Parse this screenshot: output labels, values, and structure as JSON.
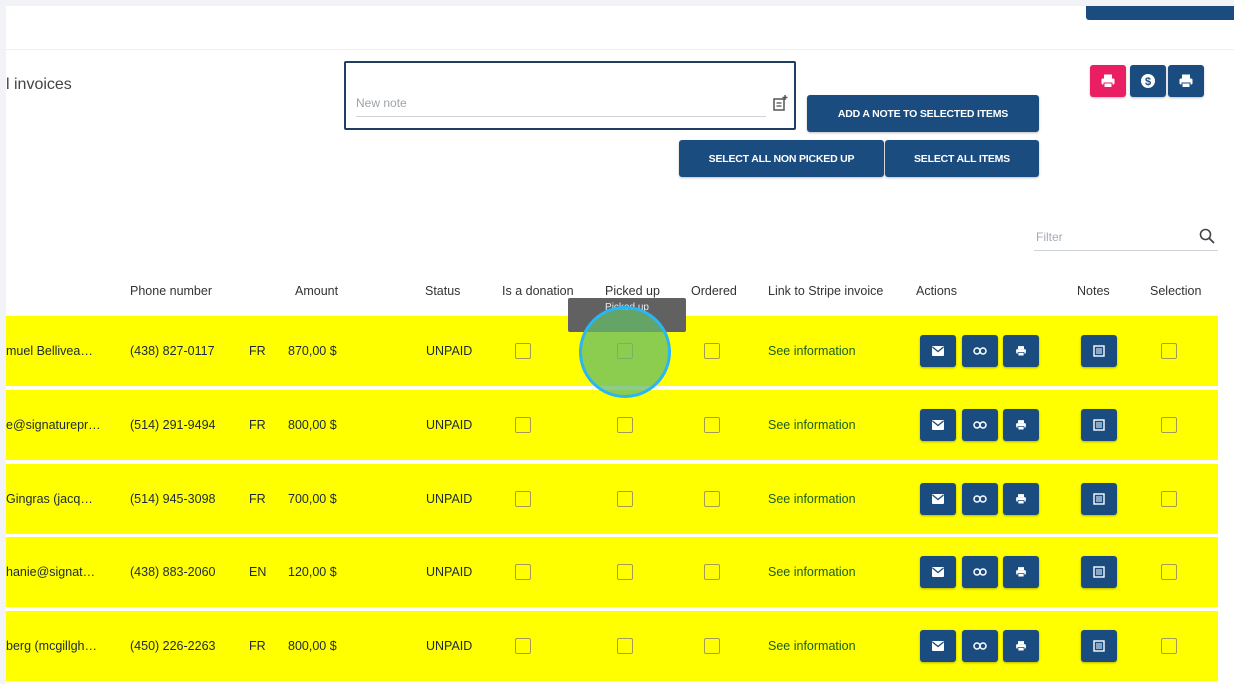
{
  "header": {
    "section_title": "l invoices"
  },
  "note": {
    "placeholder": "New note",
    "add_note_label": "ADD A NOTE TO SELECTED ITEMS",
    "select_non_picked_label": "SELECT ALL NON PICKED UP",
    "select_all_label": "SELECT ALL ITEMS"
  },
  "toolbar_icons": [
    "print-icon",
    "dollar-icon",
    "print-icon"
  ],
  "filter": {
    "placeholder": "Filter"
  },
  "table": {
    "headers": {
      "phone": "Phone number",
      "amount": "Amount",
      "status": "Status",
      "donation": "Is a donation",
      "picked": "Picked up",
      "ordered": "Ordered",
      "link": "Link to Stripe invoice",
      "actions": "Actions",
      "notes": "Notes",
      "selection": "Selection"
    },
    "rows": [
      {
        "name": "muel Bellivea…",
        "phone": "(438) 827-0117",
        "lang": "FR",
        "amount": "870,00 $",
        "status": "UNPAID",
        "link": "See information"
      },
      {
        "name": "e@signaturepr…",
        "phone": "(514) 291-9494",
        "lang": "FR",
        "amount": "800,00 $",
        "status": "UNPAID",
        "link": "See information"
      },
      {
        "name": "Gingras (jacq…",
        "phone": "(514) 945-3098",
        "lang": "FR",
        "amount": "700,00 $",
        "status": "UNPAID",
        "link": "See information"
      },
      {
        "name": "hanie@signat…",
        "phone": "(438) 883-2060",
        "lang": "EN",
        "amount": "120,00 $",
        "status": "UNPAID",
        "link": "See information"
      },
      {
        "name": "berg (mcgillgh…",
        "phone": "(450) 226-2263",
        "lang": "FR",
        "amount": "800,00 $",
        "status": "UNPAID",
        "link": "See information"
      }
    ]
  },
  "tooltip": {
    "text": "Picked up"
  },
  "colors": {
    "primary": "#1a4c80",
    "accent_pink": "#e91e63",
    "row_highlight": "#ffff00",
    "link_green": "#1b5e20"
  }
}
